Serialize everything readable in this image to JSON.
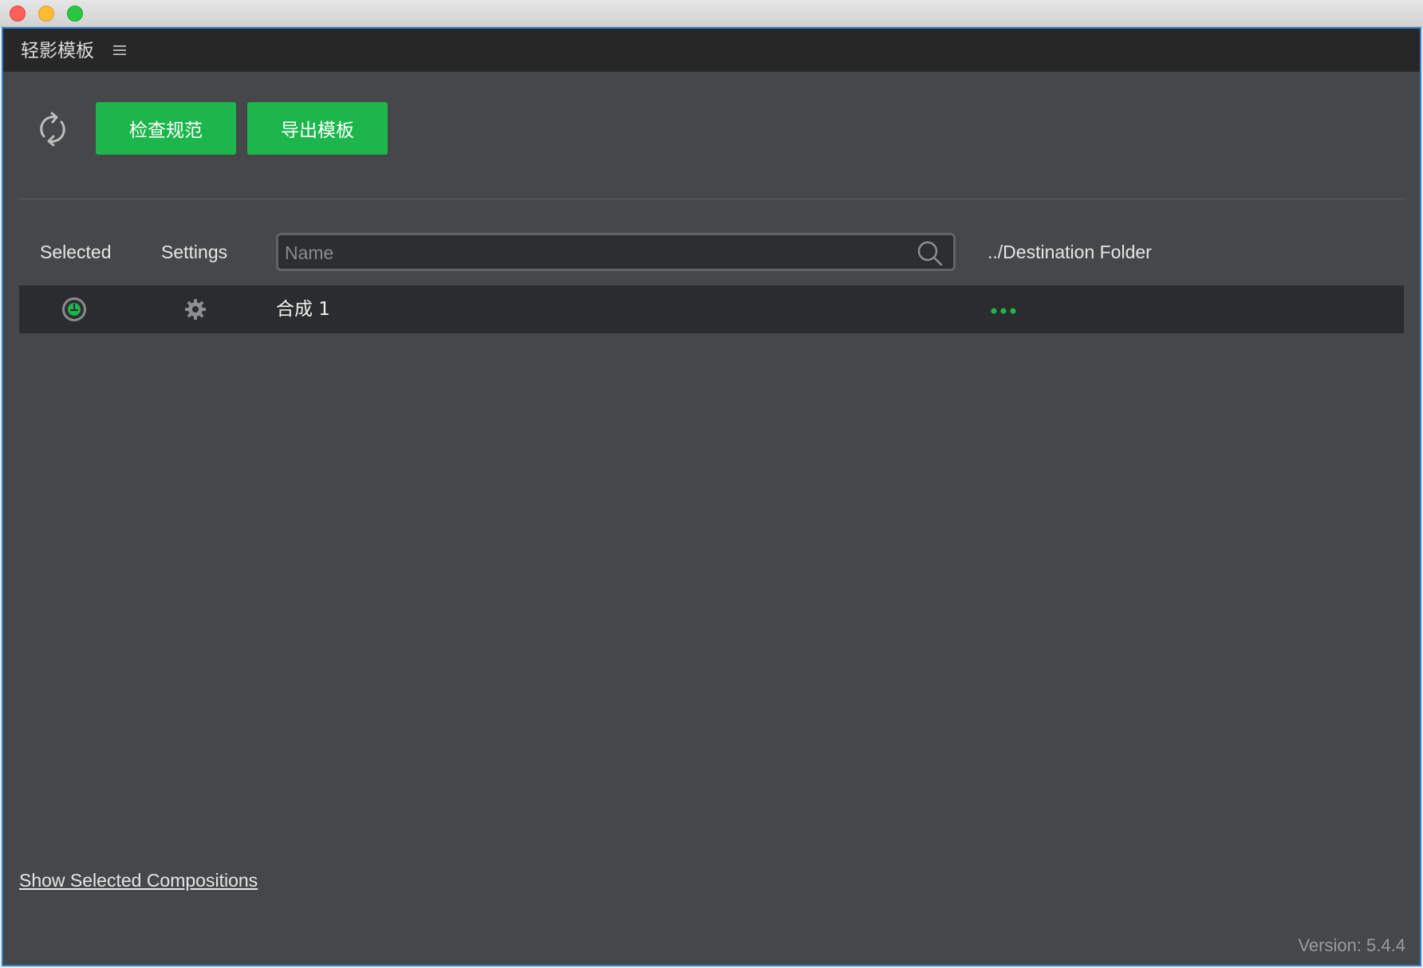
{
  "window": {
    "controls": [
      "close",
      "minimize",
      "maximize"
    ]
  },
  "header": {
    "title": "轻影模板",
    "menu_icon": "hamburger-menu-icon"
  },
  "toolbar": {
    "refresh_icon": "refresh-icon",
    "check_label": "检查规范",
    "export_label": "导出模板",
    "accent_color": "#1db64c"
  },
  "table": {
    "columns": {
      "selected": "Selected",
      "settings": "Settings",
      "destination": "../Destination Folder"
    },
    "search": {
      "placeholder": "Name",
      "value": ""
    },
    "rows": [
      {
        "selected": true,
        "name": "合成 1",
        "settings_icon": "gear-icon",
        "destination_icon": "more-dots-icon"
      }
    ]
  },
  "footer": {
    "show_selected_label": "Show Selected Compositions",
    "version": "Version: 5.4.4"
  }
}
